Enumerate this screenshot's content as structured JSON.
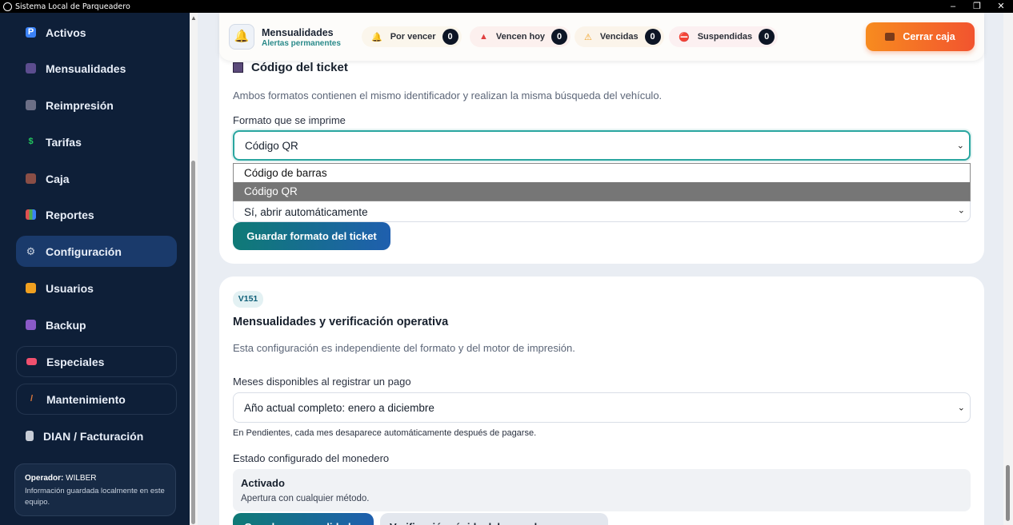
{
  "window": {
    "title": "Sistema Local de Parqueadero",
    "minimize": "–",
    "restore": "❐",
    "close": "✕"
  },
  "sidebar": {
    "items": [
      {
        "label": "Activos",
        "icon": "parking-icon",
        "color": "#3b82f6"
      },
      {
        "label": "Mensualidades",
        "icon": "users-icon",
        "color": "#7c6fb0"
      },
      {
        "label": "Reimpresión",
        "icon": "printer-icon",
        "color": "#8b8fa8"
      },
      {
        "label": "Tarifas",
        "icon": "dollar-icon",
        "color": "#22c55e"
      },
      {
        "label": "Caja",
        "icon": "briefcase-icon",
        "color": "#a0635a"
      },
      {
        "label": "Reportes",
        "icon": "chart-icon",
        "color": "#6aa1e0"
      },
      {
        "label": "Configuración",
        "icon": "gear-icon",
        "color": "#c9d2e0"
      },
      {
        "label": "Usuarios",
        "icon": "lock-icon",
        "color": "#f0a020"
      },
      {
        "label": "Backup",
        "icon": "floppy-icon",
        "color": "#8a5ac8"
      },
      {
        "label": "Especiales",
        "icon": "ticket-icon",
        "color": "#f0506e"
      },
      {
        "label": "Mantenimiento",
        "icon": "broom-icon",
        "color": "#e07a3a"
      },
      {
        "label": "DIAN / Facturación",
        "icon": "receipt-icon",
        "color": "#c7ccd6"
      }
    ],
    "operator": {
      "prefix": "Operador:",
      "name": "WILBER",
      "description": "Información guardada localmente en este equipo."
    }
  },
  "alerts": {
    "title": "Mensualidades",
    "subtitle": "Alertas permanentes",
    "pills": [
      {
        "label": "Por vencer",
        "count": "0",
        "icon": "bell-icon",
        "bg": "#fbf6ec"
      },
      {
        "label": "Vencen hoy",
        "count": "0",
        "icon": "siren-icon",
        "bg": "#fcf0ee"
      },
      {
        "label": "Vencidas",
        "count": "0",
        "icon": "warning-icon",
        "bg": "#fbf4ea"
      },
      {
        "label": "Suspendidas",
        "count": "0",
        "icon": "no-entry-icon",
        "bg": "#fcf0f1"
      }
    ],
    "close_button": "Cerrar caja"
  },
  "ticket_section": {
    "title": "Código del ticket",
    "description": "Ambos formatos contienen el mismo identificador y realizan la misma búsqueda del vehículo.",
    "format_label": "Formato que se imprime",
    "format_value": "Código QR",
    "format_options": [
      "Código de barras",
      "Código QR"
    ],
    "auto_open_value": "Sí, abrir automáticamente",
    "save_button": "Guardar formato del ticket"
  },
  "mens_section": {
    "badge": "V151",
    "title": "Mensualidades y verificación operativa",
    "description": "Esta configuración es independiente del formato y del motor de impresión.",
    "months_label": "Meses disponibles al registrar un pago",
    "months_value": "Año actual completo: enero a diciembre",
    "months_note": "En Pendientes, cada mes desaparece automáticamente después de pagarse.",
    "wallet_label": "Estado configurado del monedero",
    "wallet_status": "Activado",
    "wallet_desc": "Apertura con cualquier método.",
    "button_a": "Guardar mensualidades",
    "button_b": "Verificación rápida del monedero"
  }
}
